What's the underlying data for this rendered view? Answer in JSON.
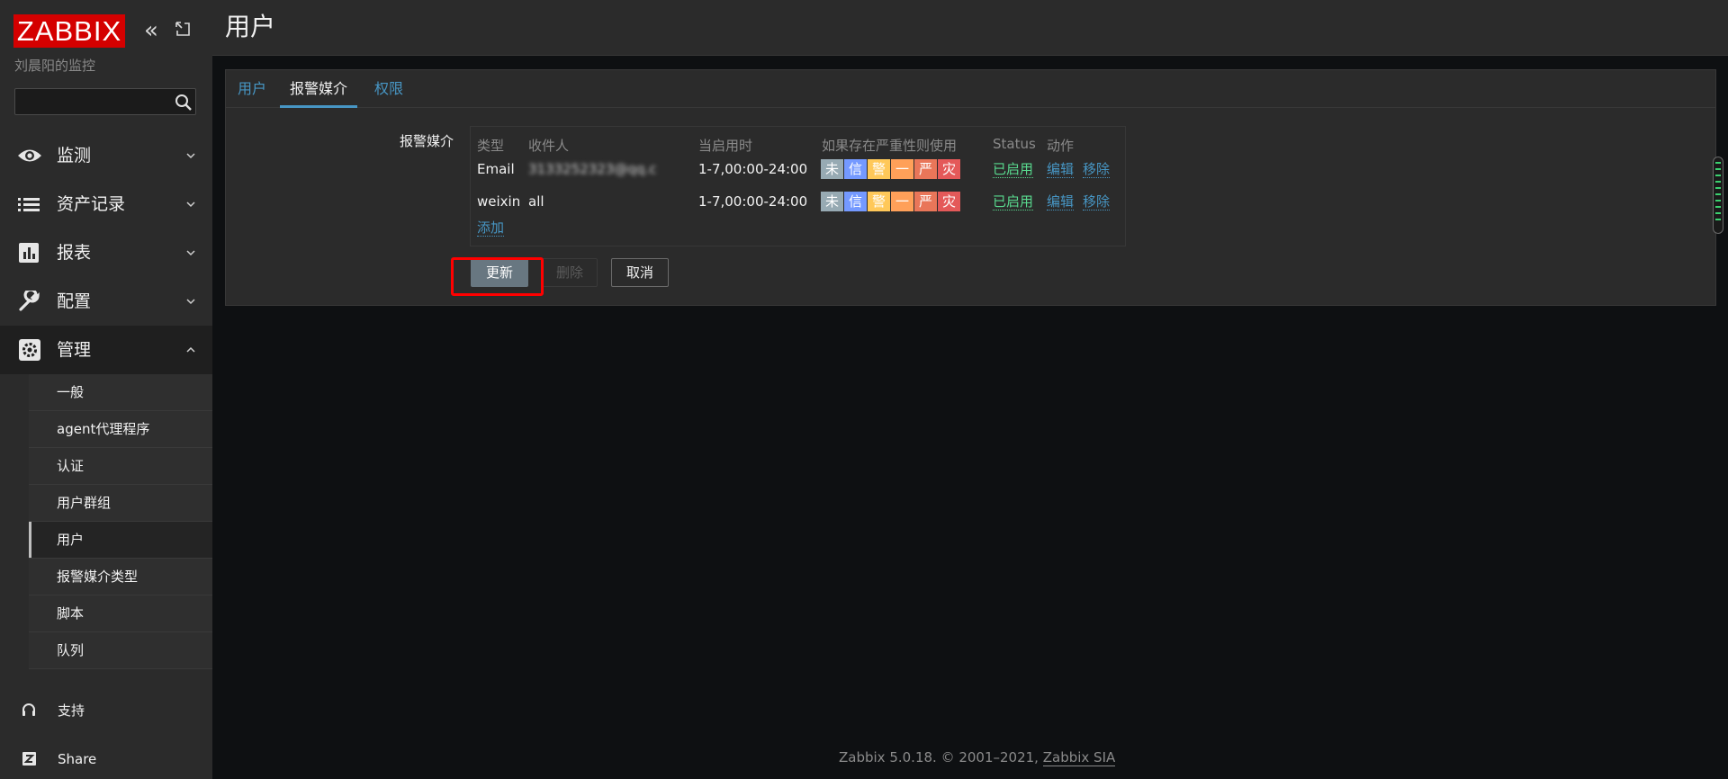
{
  "app": {
    "logo": "ZABBIX",
    "server_name": "刘晨阳的监控"
  },
  "search": {
    "placeholder": ""
  },
  "menu": [
    {
      "label": "监测",
      "icon": "eye-icon"
    },
    {
      "label": "资产记录",
      "icon": "list-icon"
    },
    {
      "label": "报表",
      "icon": "bar-chart-icon"
    },
    {
      "label": "配置",
      "icon": "wrench-icon"
    },
    {
      "label": "管理",
      "icon": "gear-icon",
      "expanded": true
    }
  ],
  "admin_submenu": [
    "一般",
    "agent代理程序",
    "认证",
    "用户群组",
    "用户",
    "报警媒介类型",
    "脚本",
    "队列"
  ],
  "selected_submenu": "用户",
  "bottom": {
    "support": "支持",
    "share": "Share"
  },
  "page": {
    "title": "用户"
  },
  "tabs": [
    {
      "label": "用户",
      "active": false
    },
    {
      "label": "报警媒介",
      "active": true
    },
    {
      "label": "权限",
      "active": false
    }
  ],
  "media": {
    "field_label": "报警媒介",
    "columns": [
      "类型",
      "收件人",
      "当启用时",
      "如果存在严重性则使用",
      "Status",
      "动作"
    ],
    "severities": [
      {
        "label": "未",
        "color": "#97aab3"
      },
      {
        "label": "信",
        "color": "#7499ff"
      },
      {
        "label": "警",
        "color": "#ffc859"
      },
      {
        "label": "一",
        "color": "#ffa059"
      },
      {
        "label": "严",
        "color": "#e97659"
      },
      {
        "label": "灾",
        "color": "#e45959"
      }
    ],
    "rows": [
      {
        "type": "Email",
        "recipient": "3133252323@qq.c",
        "when_active": "1-7,00:00-24:00",
        "status": "已启用",
        "edit": "编辑",
        "remove": "移除"
      },
      {
        "type": "weixin",
        "recipient": "all",
        "when_active": "1-7,00:00-24:00",
        "status": "已启用",
        "edit": "编辑",
        "remove": "移除"
      }
    ],
    "add_label": "添加"
  },
  "buttons": {
    "update": "更新",
    "delete": "删除",
    "cancel": "取消"
  },
  "footer": {
    "text": "Zabbix 5.0.18. © 2001–2021,",
    "link": "Zabbix SIA"
  },
  "colors": {
    "accent": "#4796c4",
    "enabled": "#59db8f",
    "logo_red": "#d40000",
    "highlight": "#ff0000"
  }
}
